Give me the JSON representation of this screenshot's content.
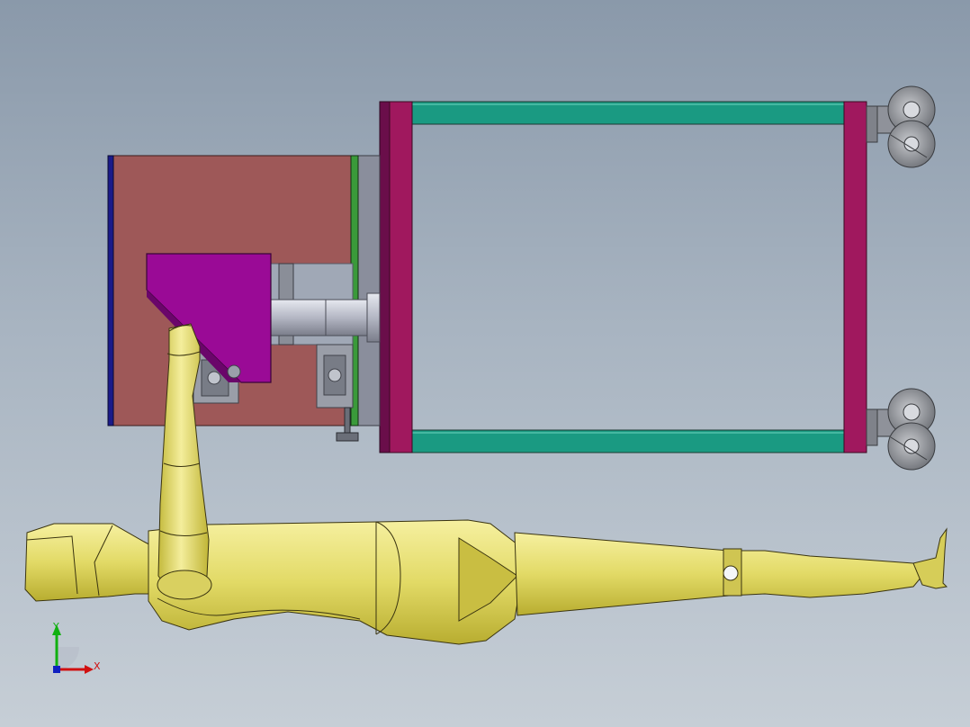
{
  "viewport": {
    "background_top": "#8a99aa",
    "background_bottom": "#c6ced6"
  },
  "model": {
    "components": [
      {
        "name": "cart-frame",
        "color": "#1a9a82"
      },
      {
        "name": "cart-uprights",
        "color": "#a0185e"
      },
      {
        "name": "mounting-plate",
        "color": "#9e5858"
      },
      {
        "name": "wedge-bracket",
        "color": "#9a0a96"
      },
      {
        "name": "shaft",
        "color": "#b9bcc8"
      },
      {
        "name": "robot-arm",
        "color": "#e8e27a"
      },
      {
        "name": "caster-wheels",
        "color": "#8f929a"
      }
    ]
  },
  "triad": {
    "x_label": "X",
    "y_label": "Y",
    "x_color": "#d01010",
    "y_color": "#10b010",
    "z_color": "#1020c0"
  }
}
